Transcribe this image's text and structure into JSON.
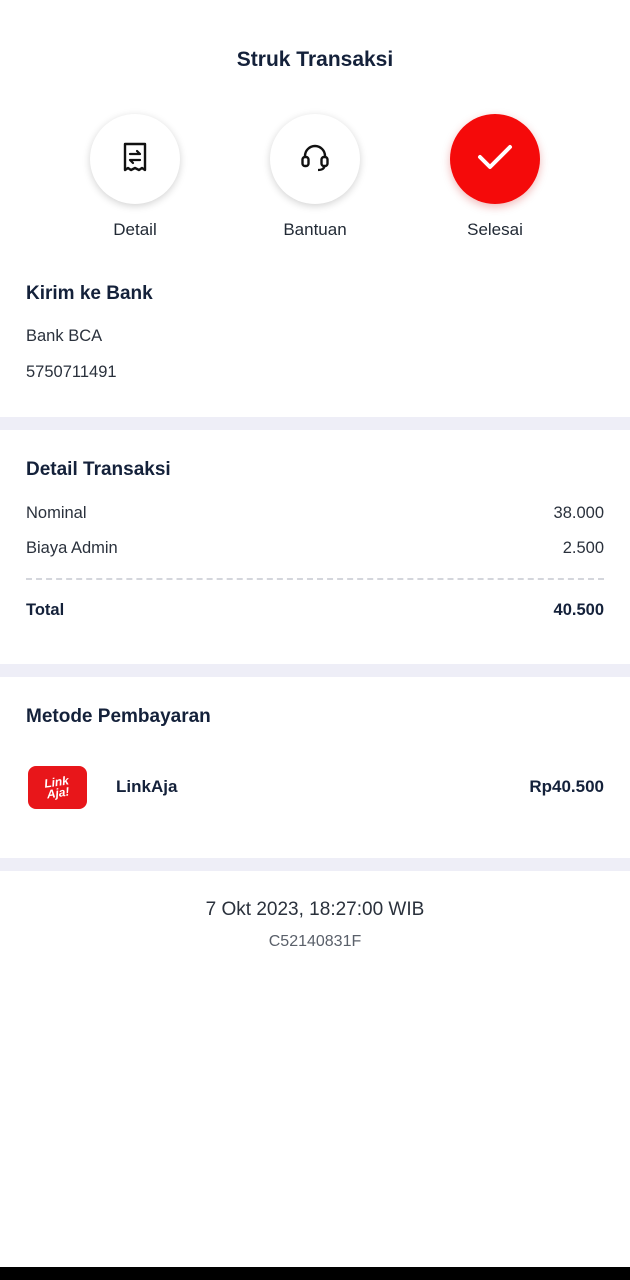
{
  "header": {
    "title": "Struk Transaksi"
  },
  "actions": [
    {
      "label": "Detail",
      "icon": "receipt-icon"
    },
    {
      "label": "Bantuan",
      "icon": "headset-icon"
    },
    {
      "label": "Selesai",
      "icon": "check-icon"
    }
  ],
  "recipient": {
    "title": "Kirim ke Bank",
    "bank": "Bank BCA",
    "account": "5750711491"
  },
  "transaction": {
    "title": "Detail Transaksi",
    "rows": [
      {
        "label": "Nominal",
        "value": "38.000"
      },
      {
        "label": "Biaya Admin",
        "value": "2.500"
      }
    ],
    "total_label": "Total",
    "total_value": "40.500"
  },
  "payment": {
    "title": "Metode Pembayaran",
    "logo_text_1": "Link",
    "logo_text_2": "Aja!",
    "method": "LinkAja",
    "amount": "Rp40.500"
  },
  "footer": {
    "datetime": "7 Okt 2023, 18:27:00 WIB",
    "ref_id": "C52140831F"
  },
  "colors": {
    "accent": "#f50a0a",
    "divider": "#eeeef7",
    "text_dark": "#14213a"
  }
}
